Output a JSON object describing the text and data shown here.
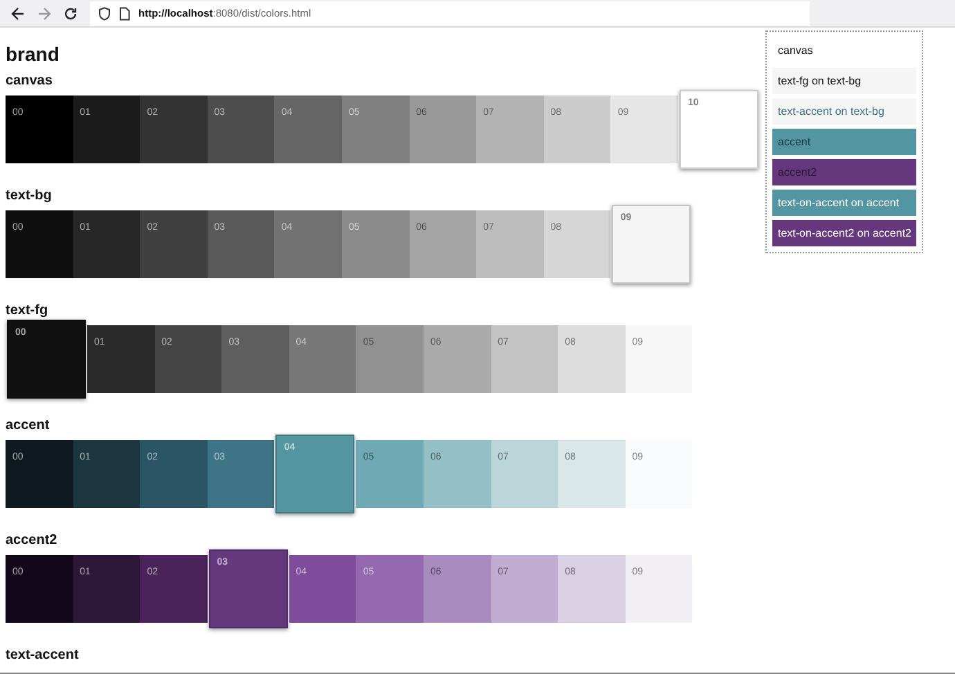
{
  "browser": {
    "url_host": "http://localhost",
    "url_rest": ":8080/dist/colors.html"
  },
  "heading": "brand",
  "palettes": [
    {
      "name": "canvas",
      "swatches": [
        {
          "label": "00",
          "color": "#000000",
          "selected": false
        },
        {
          "label": "01",
          "color": "#1b1b1b",
          "selected": false
        },
        {
          "label": "02",
          "color": "#333333",
          "selected": false
        },
        {
          "label": "03",
          "color": "#4d4d4d",
          "selected": false
        },
        {
          "label": "04",
          "color": "#666666",
          "selected": false
        },
        {
          "label": "05",
          "color": "#808080",
          "selected": false
        },
        {
          "label": "06",
          "color": "#999999",
          "selected": false
        },
        {
          "label": "07",
          "color": "#b3b3b3",
          "selected": false
        },
        {
          "label": "08",
          "color": "#cccccc",
          "selected": false
        },
        {
          "label": "09",
          "color": "#e6e6e6",
          "selected": false
        },
        {
          "label": "10",
          "color": "#ffffff",
          "selected": true
        }
      ]
    },
    {
      "name": "text-bg",
      "swatches": [
        {
          "label": "00",
          "color": "#0f0f0f",
          "selected": false
        },
        {
          "label": "01",
          "color": "#272727",
          "selected": false
        },
        {
          "label": "02",
          "color": "#404040",
          "selected": false
        },
        {
          "label": "03",
          "color": "#595959",
          "selected": false
        },
        {
          "label": "04",
          "color": "#727272",
          "selected": false
        },
        {
          "label": "05",
          "color": "#8b8b8b",
          "selected": false
        },
        {
          "label": "06",
          "color": "#a4a4a4",
          "selected": false
        },
        {
          "label": "07",
          "color": "#bdbdbd",
          "selected": false
        },
        {
          "label": "08",
          "color": "#d6d6d6",
          "selected": false
        },
        {
          "label": "09",
          "color": "#f4f5f4",
          "selected": true
        }
      ]
    },
    {
      "name": "text-fg",
      "swatches": [
        {
          "label": "00",
          "color": "#111111",
          "selected": true
        },
        {
          "label": "01",
          "color": "#2a2a2a",
          "selected": false
        },
        {
          "label": "02",
          "color": "#444444",
          "selected": false
        },
        {
          "label": "03",
          "color": "#5e5e5e",
          "selected": false
        },
        {
          "label": "04",
          "color": "#777777",
          "selected": false
        },
        {
          "label": "05",
          "color": "#919191",
          "selected": false
        },
        {
          "label": "06",
          "color": "#aaaaaa",
          "selected": false
        },
        {
          "label": "07",
          "color": "#c4c4c4",
          "selected": false
        },
        {
          "label": "08",
          "color": "#dddddd",
          "selected": false
        },
        {
          "label": "09",
          "color": "#f7f7f7",
          "selected": false
        }
      ]
    },
    {
      "name": "accent",
      "swatches": [
        {
          "label": "00",
          "color": "#0e1a1f",
          "selected": false
        },
        {
          "label": "01",
          "color": "#1c3640",
          "selected": false
        },
        {
          "label": "02",
          "color": "#2b5564",
          "selected": false
        },
        {
          "label": "03",
          "color": "#3d7486",
          "selected": false
        },
        {
          "label": "04",
          "color": "#5495a2",
          "selected": true
        },
        {
          "label": "05",
          "color": "#6fa9b4",
          "selected": false
        },
        {
          "label": "06",
          "color": "#95bfc6",
          "selected": false
        },
        {
          "label": "07",
          "color": "#bad6d9",
          "selected": false
        },
        {
          "label": "08",
          "color": "#d9e7e8",
          "selected": false
        },
        {
          "label": "09",
          "color": "#f8fafb",
          "selected": false
        }
      ]
    },
    {
      "name": "accent2",
      "swatches": [
        {
          "label": "00",
          "color": "#12081a",
          "selected": false
        },
        {
          "label": "01",
          "color": "#2c1739",
          "selected": false
        },
        {
          "label": "02",
          "color": "#4a2459",
          "selected": false
        },
        {
          "label": "03",
          "color": "#65387e",
          "selected": true
        },
        {
          "label": "04",
          "color": "#7e4c9b",
          "selected": false
        },
        {
          "label": "05",
          "color": "#9569af",
          "selected": false
        },
        {
          "label": "06",
          "color": "#a98bbe",
          "selected": false
        },
        {
          "label": "07",
          "color": "#c2add2",
          "selected": false
        },
        {
          "label": "08",
          "color": "#dad0e4",
          "selected": false
        },
        {
          "label": "09",
          "color": "#f2eff4",
          "selected": false
        }
      ]
    },
    {
      "name": "text-accent"
    }
  ],
  "samples": [
    {
      "text": "canvas",
      "kind": "plain",
      "color": "#ffffff"
    },
    {
      "text": "text-fg on text-bg",
      "kind": "plain",
      "color": "#f4f5f4"
    },
    {
      "text": "text-accent on text-bg",
      "kind": "accent",
      "color": "#f4f5f4"
    },
    {
      "text": "accent",
      "kind": "dim",
      "color": "#5495a2"
    },
    {
      "text": "accent2",
      "kind": "dim2",
      "color": "#65387e"
    },
    {
      "text": "text-on-accent on accent",
      "kind": "inverse",
      "color": "#5495a2"
    },
    {
      "text": "text-on-accent2 on accent2",
      "kind": "inverse",
      "color": "#65387e"
    }
  ]
}
